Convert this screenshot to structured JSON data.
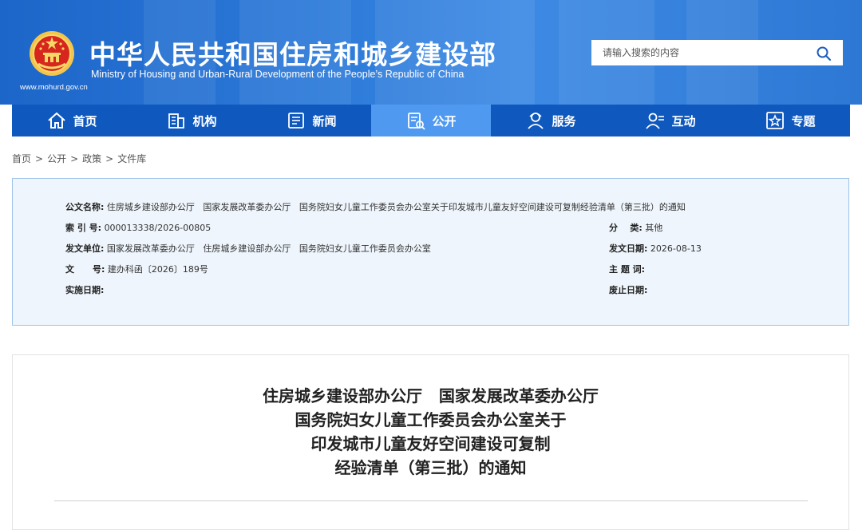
{
  "header": {
    "title_cn": "中华人民共和国住房和城乡建设部",
    "title_en": "Ministry of Housing and Urban-Rural Development of the People’s Republic of China",
    "site_url": "www.mohurd.gov.cn",
    "search": {
      "placeholder": "请输入搜索的内容"
    },
    "emblem_icon": "national-emblem-icon",
    "search_icon": "search-icon"
  },
  "nav": [
    {
      "label": "首页",
      "icon": "home-icon"
    },
    {
      "label": "机构",
      "icon": "building-icon"
    },
    {
      "label": "新闻",
      "icon": "news-icon"
    },
    {
      "label": "公开",
      "icon": "open-document-icon"
    },
    {
      "label": "服务",
      "icon": "service-person-icon"
    },
    {
      "label": "互动",
      "icon": "interaction-person-icon"
    },
    {
      "label": "专题",
      "icon": "topic-star-icon"
    }
  ],
  "breadcrumb": [
    "首页",
    "公开",
    "政策",
    "文件库"
  ],
  "info": {
    "doc_name_label": "公文名称:",
    "doc_name": "住房城乡建设部办公厅   国家发展改革委办公厅   国务院妇女儿童工作委员会办公室关于印发城市儿童友好空间建设可复制经验清单（第三批）的通知",
    "index_label": "索 引 号:",
    "index": "000013338/2026-00805",
    "category_label": "分    类:",
    "category": "其他",
    "issuer_label": "发文单位:",
    "issuer": "国家发展改革委办公厅   住房城乡建设部办公厅   国务院妇女儿童工作委员会办公室",
    "date_label": "发文日期:",
    "date": "2026-08-13",
    "doc_no_label": "文      号:",
    "doc_no": "建办科函〔2026〕189号",
    "subject_label": "主 题 词:",
    "subject": "",
    "effective_label": "实施日期:",
    "effective": "",
    "expiry_label": "废止日期:",
    "expiry": ""
  },
  "article": {
    "title_lines": [
      "住房城乡建设部办公厅   国家发展改革委办公厅",
      "国务院妇女儿童工作委员会办公室关于",
      "印发城市儿童友好空间建设可复制",
      "经验清单（第三批）的通知"
    ]
  },
  "colors": {
    "header_blue": "#2a78d8",
    "nav_blue": "#0f58bd",
    "nav_active": "#4f9af0",
    "info_bg": "#eef5fc",
    "info_border": "#9ec3ea"
  }
}
